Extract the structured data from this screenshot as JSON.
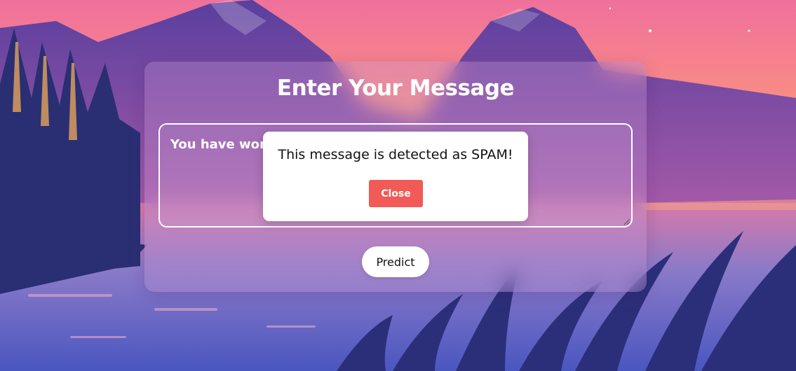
{
  "page": {
    "title": "Enter Your Message",
    "message_text": "You have won",
    "predict_label": "Predict"
  },
  "modal": {
    "text": "This message is detected as SPAM!",
    "close_label": "Close"
  },
  "colors": {
    "sky_top": "#f46f9a",
    "sky_horizon": "#ffd25e",
    "mountain": "#6a4aa8",
    "trees": "#2a2f73",
    "lake": "#5b67c9",
    "close_button": "#f15a56"
  }
}
